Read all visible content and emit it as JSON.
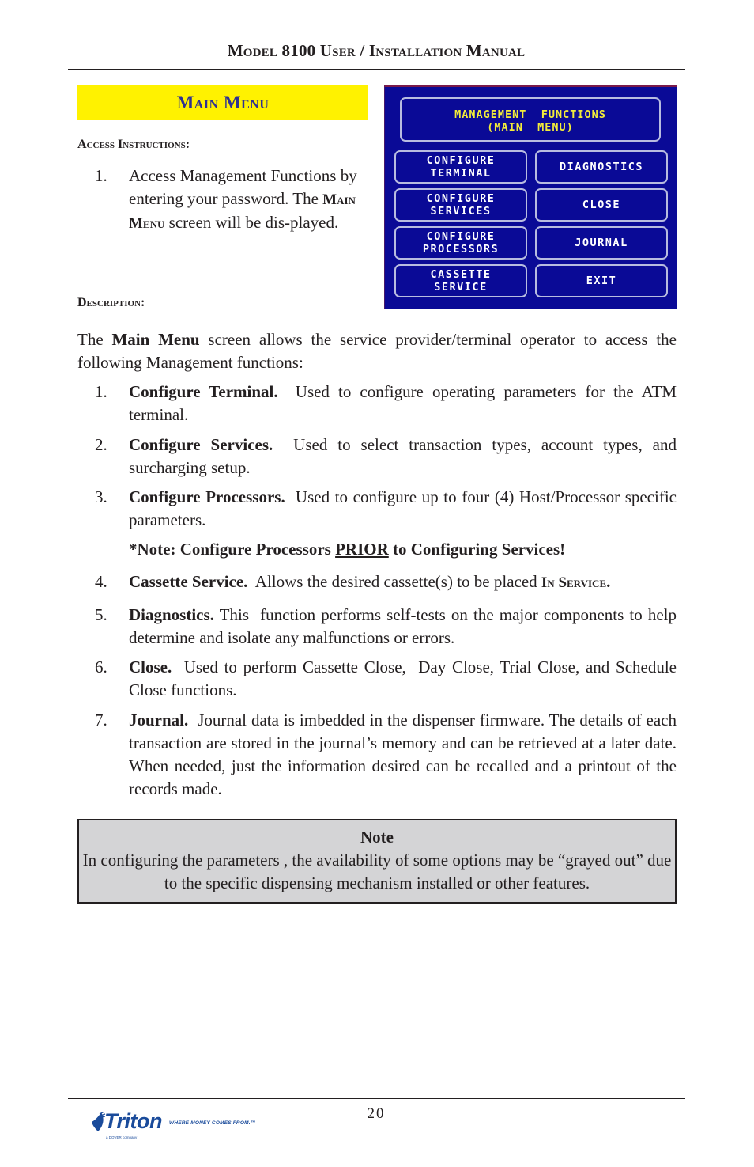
{
  "header": {
    "title": "Model 8100 User / Installation Manual"
  },
  "section": {
    "title": "Main Menu"
  },
  "access": {
    "heading": "Access Instructions:",
    "steps": [
      {
        "num": "1.",
        "pre": "Access Management Functions by entering your password. The ",
        "sc": "Main Menu",
        "post": " screen will be dis-played."
      }
    ]
  },
  "description": {
    "heading": "Description:",
    "intro_pre": "The ",
    "intro_bold": "Main Menu",
    "intro_post": " screen allows the service provider/terminal operator to access the following Management functions:",
    "items": [
      {
        "num": "1.",
        "term": "Configure Terminal.",
        "text": "  Used to configure operating parameters for the ATM terminal."
      },
      {
        "num": "2.",
        "term": "Configure Services.",
        "text": "  Used to select transaction types, account types, and surcharging setup."
      },
      {
        "num": "3.",
        "term": "Configure Processors.",
        "text": "  Used to configure up to four (4) Host/Processor specific parameters."
      },
      {
        "num": "4.",
        "term": "Cassette Service.",
        "text": "  Allows the desired cassette(s) to be placed ",
        "sc": "In Service",
        "post": "."
      },
      {
        "num": "5.",
        "term": "Diagnostics.",
        "text": " This  function performs self-tests on the major components to help determine and isolate any malfunctions or errors."
      },
      {
        "num": "6.",
        "term": "Close.",
        "text": "  Used to perform Cassette Close,  Day Close, Trial Close, and Schedule Close functions."
      },
      {
        "num": "7.",
        "term": "Journal.",
        "text": "  Journal data is imbedded in the dispenser firmware. The details of each transaction are stored in the journal’s memory and can be retrieved at a later date.  When needed, just the information desired can be recalled and a printout of the records made."
      }
    ],
    "processor_note": {
      "pre": "*Note: Configure Processors ",
      "underlined": "PRIOR",
      "post": " to Configuring Services!"
    }
  },
  "atm_screen": {
    "title_line1": "MANAGEMENT  FUNCTIONS",
    "title_line2": "(MAIN  MENU)",
    "buttons": [
      {
        "label": "CONFIGURE\nTERMINAL"
      },
      {
        "label": "DIAGNOSTICS"
      },
      {
        "label": "CONFIGURE\nSERVICES"
      },
      {
        "label": "CLOSE"
      },
      {
        "label": "CONFIGURE\nPROCESSORS"
      },
      {
        "label": "JOURNAL"
      },
      {
        "label": "CASSETTE\nSERVICE"
      },
      {
        "label": "EXIT"
      }
    ],
    "colors": {
      "background": "#0a0a96",
      "title_text": "#f2ec3a",
      "button_text": "#ffffff",
      "border": "#b8bce0"
    }
  },
  "note_box": {
    "title": "Note",
    "text": "In configuring the parameters , the availability of some options may be “grayed out” due to the specific dispensing mechanism installed or other features."
  },
  "footer": {
    "page_number": "20",
    "logo_wordmark": "Triton",
    "logo_tagline": "WHERE MONEY COMES FROM.™",
    "logo_sub": "a DOVER company"
  },
  "colors": {
    "banner_bg": "#fff200",
    "banner_text": "#2e3192",
    "note_bg": "#d4d4d6",
    "brand": "#1a4b9b"
  }
}
